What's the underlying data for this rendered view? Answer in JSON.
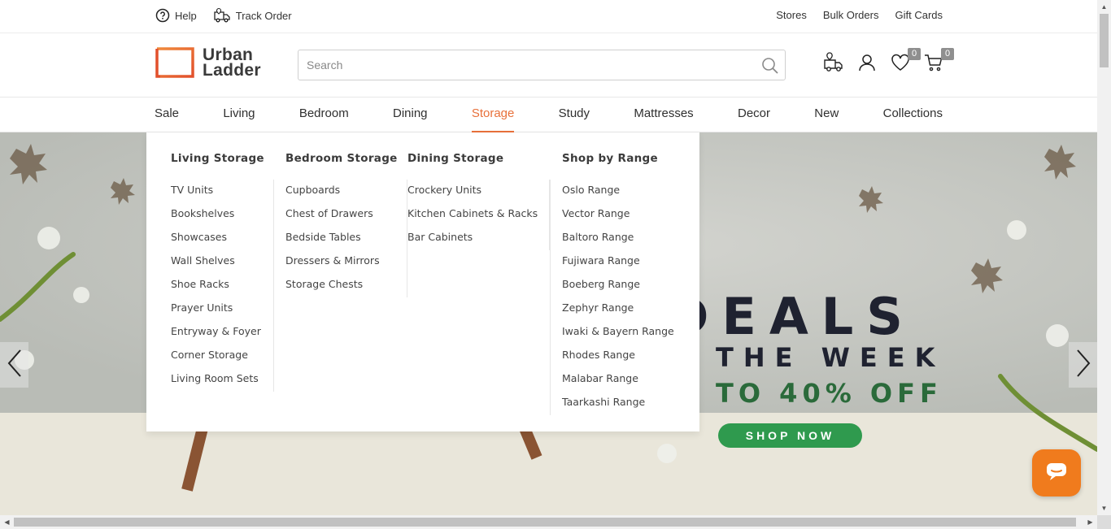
{
  "topbar": {
    "left": [
      {
        "label": "Help",
        "icon": "help-circle-icon"
      },
      {
        "label": "Track Order",
        "icon": "delivery-truck-icon"
      }
    ],
    "right": [
      "Stores",
      "Bulk Orders",
      "Gift Cards"
    ]
  },
  "header": {
    "logo_line1": "Urban",
    "logo_line2": "Ladder",
    "search_placeholder": "Search",
    "wishlist_count": "0",
    "cart_count": "0"
  },
  "nav": {
    "items": [
      "Sale",
      "Living",
      "Bedroom",
      "Dining",
      "Storage",
      "Study",
      "Mattresses",
      "Decor",
      "New",
      "Collections"
    ],
    "active": "Storage"
  },
  "dropdown": {
    "columns": [
      {
        "heading": "Living Storage",
        "items": [
          "TV Units",
          "Bookshelves",
          "Showcases",
          "Wall Shelves",
          "Shoe Racks",
          "Prayer Units",
          "Entryway & Foyer",
          "Corner Storage",
          "Living Room Sets"
        ]
      },
      {
        "heading": "Bedroom Storage",
        "items": [
          "Cupboards",
          "Chest of Drawers",
          "Bedside Tables",
          "Dressers & Mirrors",
          "Storage Chests"
        ]
      },
      {
        "heading": "Dining Storage",
        "items": [
          "Crockery Units",
          "Kitchen Cabinets & Racks",
          "Bar Cabinets"
        ]
      },
      {
        "heading": "Shop by Range",
        "items": [
          "Oslo Range",
          "Vector Range",
          "Baltoro Range",
          "Fujiwara Range",
          "Boeberg Range",
          "Zephyr Range",
          "Iwaki & Bayern Range",
          "Rhodes Range",
          "Malabar Range",
          "Taarkashi Range"
        ]
      }
    ]
  },
  "hero": {
    "deals": "DEALS",
    "week": "THE WEEK",
    "off": "TO 40% OFF",
    "cta": "SHOP NOW"
  },
  "colors": {
    "accent": "#e8703a",
    "cta_green": "#2f9a4e",
    "chat_orange": "#f07b1d"
  }
}
